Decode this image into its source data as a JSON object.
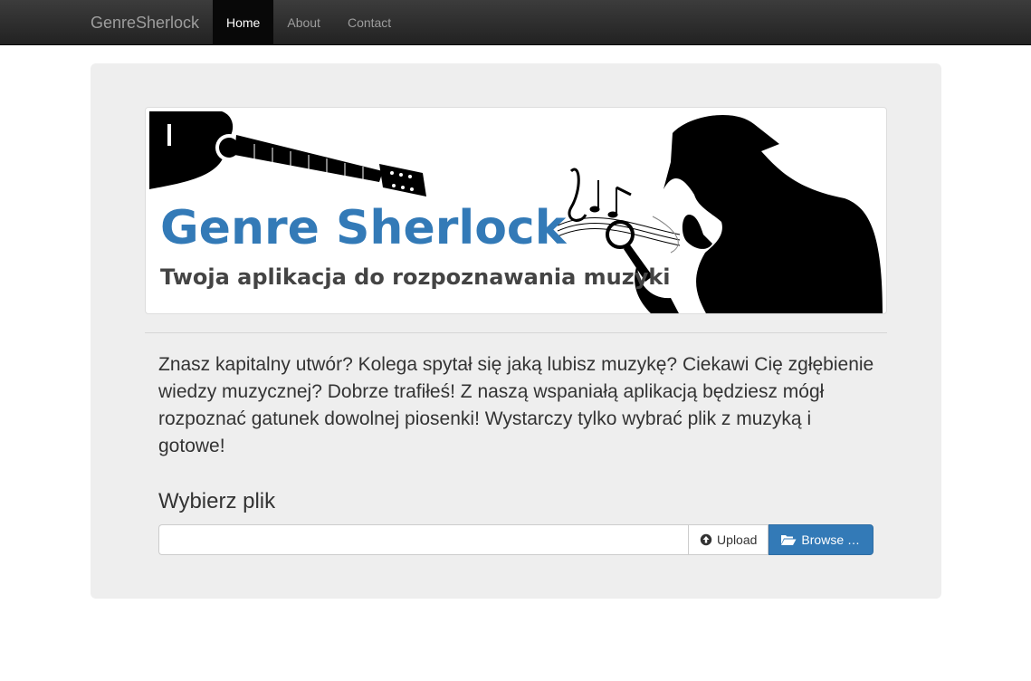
{
  "navbar": {
    "brand": "GenreSherlock",
    "items": [
      {
        "label": "Home",
        "active": true
      },
      {
        "label": "About",
        "active": false
      },
      {
        "label": "Contact",
        "active": false
      }
    ]
  },
  "banner": {
    "title": "Genre Sherlock",
    "subtitle": "Twoja aplikacja do rozpoznawania muzyki",
    "title_color": "#337ab7"
  },
  "intro": {
    "text": "Znasz kapitalny utwór? Kolega spytał się jaką lubisz muzykę? Ciekawi Cię zgłębienie wiedzy muzycznej? Dobrze trafiłeś! Z naszą wspaniałą aplikacją będziesz mógł rozpoznać gatunek dowolnej piosenki! Wystarczy tylko wybrać plik z muzyką i gotowe!"
  },
  "upload": {
    "heading": "Wybierz plik",
    "file_value": "",
    "upload_label": "Upload",
    "upload_icon": "upload-circle-icon",
    "browse_label": "Browse …",
    "browse_icon": "folder-open-icon",
    "accent": "#337ab7"
  }
}
